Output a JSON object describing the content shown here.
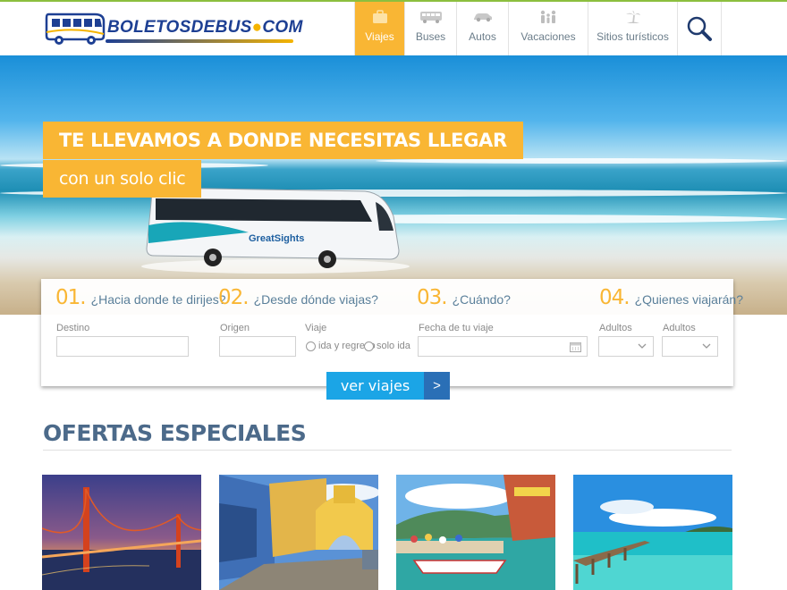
{
  "brand": {
    "logo_main": "BOLETOSDEBUS",
    "logo_dot": "●",
    "logo_tld": "COM",
    "accent": "#f9b634",
    "blue": "#1d3f93"
  },
  "nav": {
    "items": [
      {
        "label": "Viajes",
        "icon": "suitcase-icon",
        "active": true
      },
      {
        "label": "Buses",
        "icon": "bus-icon"
      },
      {
        "label": "Autos",
        "icon": "car-icon"
      },
      {
        "label": "Vacaciones",
        "icon": "family-icon"
      },
      {
        "label": "Sitios turísticos",
        "icon": "palm-tree-icon"
      }
    ],
    "search_icon": "search-icon"
  },
  "hero": {
    "line1": "TE LLEVAMOS A DONDE NECESITAS LLEGAR",
    "line2": "con un solo clic",
    "bus_brand": "GreatSights"
  },
  "search": {
    "steps": [
      {
        "num": "01.",
        "question": "¿Hacia donde te dirijes?"
      },
      {
        "num": "02.",
        "question": "¿Desde dónde viajas?"
      },
      {
        "num": "03.",
        "question": "¿Cuándo?"
      },
      {
        "num": "04.",
        "question": "¿Quienes viajarán?"
      }
    ],
    "destino_label": "Destino",
    "origen_label": "Origen",
    "viaje_label": "Viaje",
    "radio_round": "ida y regreso",
    "radio_oneway": "solo ida",
    "fecha_label": "Fecha de tu viaje",
    "adultos_label_1": "Adultos",
    "adultos_label_2": "Adultos",
    "button_label": "ver viajes",
    "button_arrow": ">"
  },
  "offers": {
    "title": "OFERTAS ESPECIALES",
    "cards": [
      {
        "name": "offer-golden-gate"
      },
      {
        "name": "offer-colonial-street"
      },
      {
        "name": "offer-harbor-boats"
      },
      {
        "name": "offer-tropical-pier"
      }
    ]
  }
}
